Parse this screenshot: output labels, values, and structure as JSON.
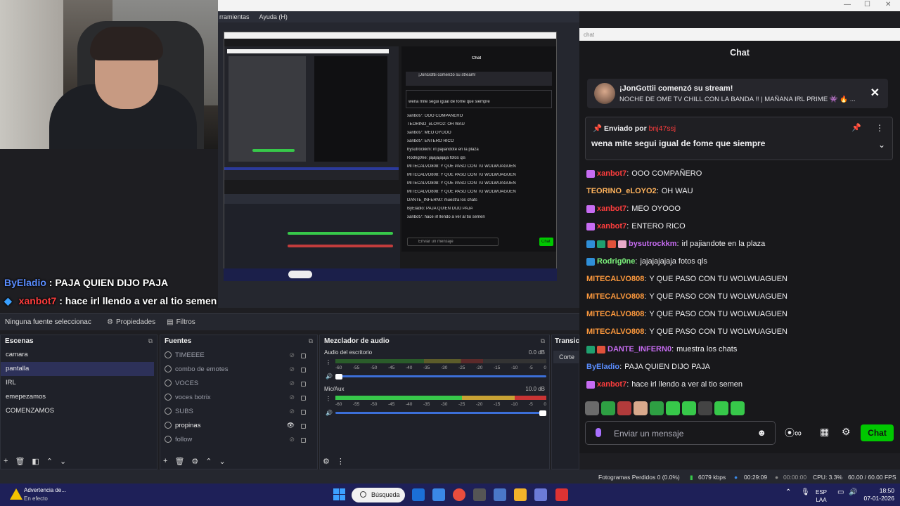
{
  "menu": {
    "items": [
      "rramientas",
      "Ayuda (H)"
    ]
  },
  "chat_window": {
    "titlebar_label": "chat",
    "header": "Chat",
    "stream_notice": {
      "title": "¡JonGottii comenzó su stream!",
      "subtitle": "NOCHE DE OME TV CHILL CON LA BANDA !! | MAÑANA IRL PRIME 👾 🔥 ..."
    },
    "pinned": {
      "label": "Enviado por",
      "author": "bnj47ssj",
      "text": "wena mite segui igual de fome que siempre"
    },
    "messages": [
      {
        "user": "xanbot7",
        "color": "#ff3d3d",
        "text": "OOO COMPAÑERO",
        "badges": [
          "#c76cf2"
        ]
      },
      {
        "user": "TEORINO_eLOYO2",
        "color": "#ffb35c",
        "text": "OH WAU",
        "badges": []
      },
      {
        "user": "xanbot7",
        "color": "#ff3d3d",
        "text": "MEO OYOOO",
        "badges": [
          "#c76cf2"
        ]
      },
      {
        "user": "xanbot7",
        "color": "#ff3d3d",
        "text": "ENTERO RICO",
        "badges": [
          "#c76cf2"
        ]
      },
      {
        "user": "bysutrockkm",
        "color": "#c76cf2",
        "text": "irl pajiandote en la plaza",
        "badges": [
          "#2f8fd8",
          "#1fa06f",
          "#e0513b",
          "#e9a9c9"
        ]
      },
      {
        "user": "Rodrig0ne",
        "color": "#7cf27c",
        "text": "jajajajajaja fotos qls",
        "badges": [
          "#2f8fd8"
        ]
      },
      {
        "user": "MITECALVO808",
        "color": "#ff9a3d",
        "text": "Y QUE PASO CON TU WOLWUAGUEN",
        "badges": []
      },
      {
        "user": "MITECALVO808",
        "color": "#ff9a3d",
        "text": "Y QUE PASO CON TU WOLWUAGUEN",
        "badges": []
      },
      {
        "user": "MITECALVO808",
        "color": "#ff9a3d",
        "text": "Y QUE PASO CON TU WOLWUAGUEN",
        "badges": []
      },
      {
        "user": "MITECALVO808",
        "color": "#ff9a3d",
        "text": "Y QUE PASO CON TU WOLWUAGUEN",
        "badges": []
      },
      {
        "user": "DANTE_INFERN0",
        "color": "#c76cf2",
        "text": "muestra los chats",
        "badges": [
          "#1fa06f",
          "#e0513b"
        ]
      },
      {
        "user": "ByEladio",
        "color": "#5a8dff",
        "text": "PAJA QUIEN DIJO PAJA",
        "badges": []
      },
      {
        "user": "xanbot7",
        "color": "#ff3d3d",
        "text": "hace irl llendo a ver al tio semen",
        "badges": [
          "#c76cf2"
        ]
      }
    ],
    "emotes": [
      "#6b6b6b",
      "#2ea043",
      "#b23b3b",
      "#d9a98c",
      "#2ea043",
      "#37c84a",
      "#37c84a",
      "#444",
      "#37c84a",
      "#37c84a"
    ],
    "input_placeholder": "Enviar un mensaje",
    "send_label": "Chat"
  },
  "overlay_chat": [
    {
      "user": "ByEladio",
      "color": "#5a8dff",
      "text": ": PAJA QUIEN DIJO PAJA"
    },
    {
      "user": "xanbot7",
      "color": "#ff3d3d",
      "text": ": hace irl llendo a ver al tio semen"
    }
  ],
  "sourcebar": {
    "selected": "Ninguna fuente seleccionac",
    "properties": "Propiedades",
    "filters": "Filtros"
  },
  "scenes": {
    "title": "Escenas",
    "items": [
      {
        "label": "camara",
        "active": false
      },
      {
        "label": "pantalla",
        "active": true
      },
      {
        "label": "IRL",
        "active": false
      },
      {
        "label": "emepezamos",
        "active": false
      },
      {
        "label": "COMENZAMOS",
        "active": false
      }
    ]
  },
  "sources": {
    "title": "Fuentes",
    "items": [
      {
        "label": "TIMEEEE",
        "visible": false
      },
      {
        "label": "combo de emotes",
        "visible": false
      },
      {
        "label": "VOCES",
        "visible": false
      },
      {
        "label": "voces botrix",
        "visible": false
      },
      {
        "label": "SUBS",
        "visible": false
      },
      {
        "label": "propinas",
        "visible": true
      },
      {
        "label": "follow",
        "visible": false
      }
    ]
  },
  "mixer": {
    "title": "Mezclador de audio",
    "tracks": [
      {
        "name": "Audio del escritorio",
        "db": "0.0 dB",
        "level": 0.0
      },
      {
        "name": "Mic/Aux",
        "db": "10.0 dB",
        "level": 1.0
      }
    ],
    "ticks": [
      "-60",
      "-55",
      "-50",
      "-45",
      "-40",
      "-35",
      "-30",
      "-25",
      "-20",
      "-15",
      "-10",
      "-5",
      "0"
    ]
  },
  "transitions": {
    "title": "Transici",
    "mode": "Corte"
  },
  "status": {
    "dropped": "Fotogramas Perdidos 0 (0.0%)",
    "bitrate": "6079 kbps",
    "live_time": "00:29:09",
    "rec_time": "00:00:00",
    "cpu": "CPU: 3.3%",
    "fps": "60.00 / 60.00 FPS"
  },
  "taskbar": {
    "warning_title": "Advertencia de...",
    "warning_sub": "En efecto",
    "search": "Búsqueda",
    "lang": "ESP",
    "region": "LAA",
    "time": "18:50",
    "date": "07-01-2026",
    "app_colors": [
      "#1b6fd6",
      "#3a88e6",
      "#e94d3d",
      "#555",
      "#4a78c8",
      "#f2b32a",
      "#6c7bd8",
      "#d33"
    ]
  },
  "mini": {
    "chat_header": "Chat",
    "notice": "¡JonGottii comenzó su stream!",
    "pinned": "wena mite segui igual de fome que siempre",
    "input": "Enviar un mensaje",
    "send": "Chat",
    "lines": [
      "xanbot7: OOO COMPAÑERO",
      "TEORINO_eLOYO2: OH WAU",
      "xanbot7: MEO OYOOO",
      "xanbot7: ENTERO RICO",
      "bysutrockkm: irl pajiandote en la plaza",
      "Rodrig0ne: jajajajajaja fotos qls",
      "MITECALVO808: Y QUE PASO CON TU WOLWUAGUEN",
      "MITECALVO808: Y QUE PASO CON TU WOLWUAGUEN",
      "MITECALVO808: Y QUE PASO CON TU WOLWUAGUEN",
      "MITECALVO808: Y QUE PASO CON TU WOLWUAGUEN",
      "DANTE_INFERN0: muestra los chats",
      "ByEladio: PAJA QUIEN DIJO PAJA",
      "xanbot7: hace irl llendo a ver al tio semen"
    ]
  }
}
